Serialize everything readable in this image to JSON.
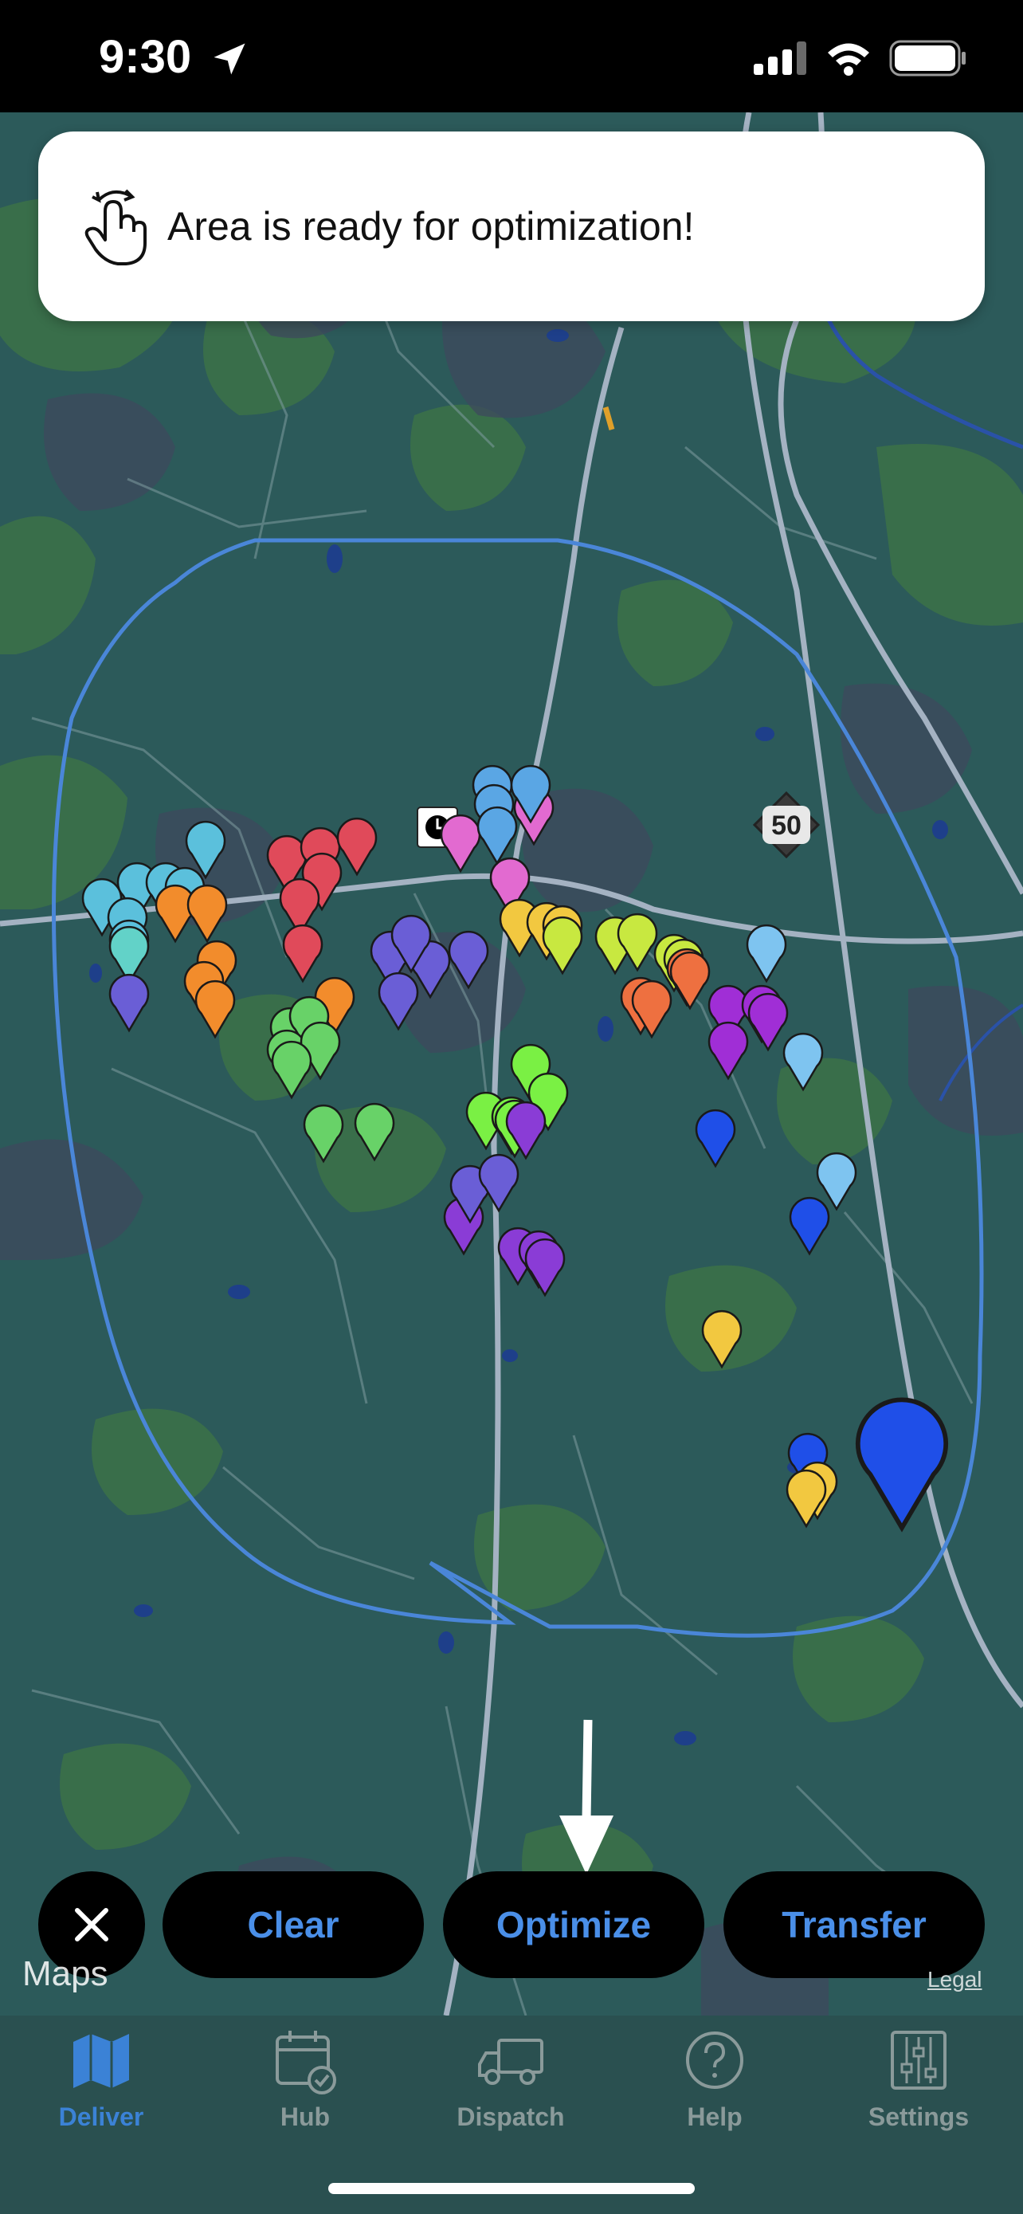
{
  "status_bar": {
    "time": "9:30"
  },
  "banner": {
    "text": "Area is ready for optimization!"
  },
  "map": {
    "highway_shield": "50"
  },
  "actions": {
    "clear": "Clear",
    "optimize": "Optimize",
    "transfer": "Transfer"
  },
  "attribution": {
    "maps": "Maps",
    "legal": "Legal"
  },
  "tabs": [
    {
      "label": "Deliver",
      "icon": "map-icon",
      "active": true
    },
    {
      "label": "Hub",
      "icon": "calendar-check-icon",
      "active": false
    },
    {
      "label": "Dispatch",
      "icon": "truck-icon",
      "active": false
    },
    {
      "label": "Help",
      "icon": "question-icon",
      "active": false
    },
    {
      "label": "Settings",
      "icon": "sliders-icon",
      "active": false
    }
  ],
  "colors": {
    "accent": "#3b82d6",
    "button_text": "#4a8fe8",
    "map_bg": "#2c5a5a",
    "area_outline": "#4a86d8"
  }
}
